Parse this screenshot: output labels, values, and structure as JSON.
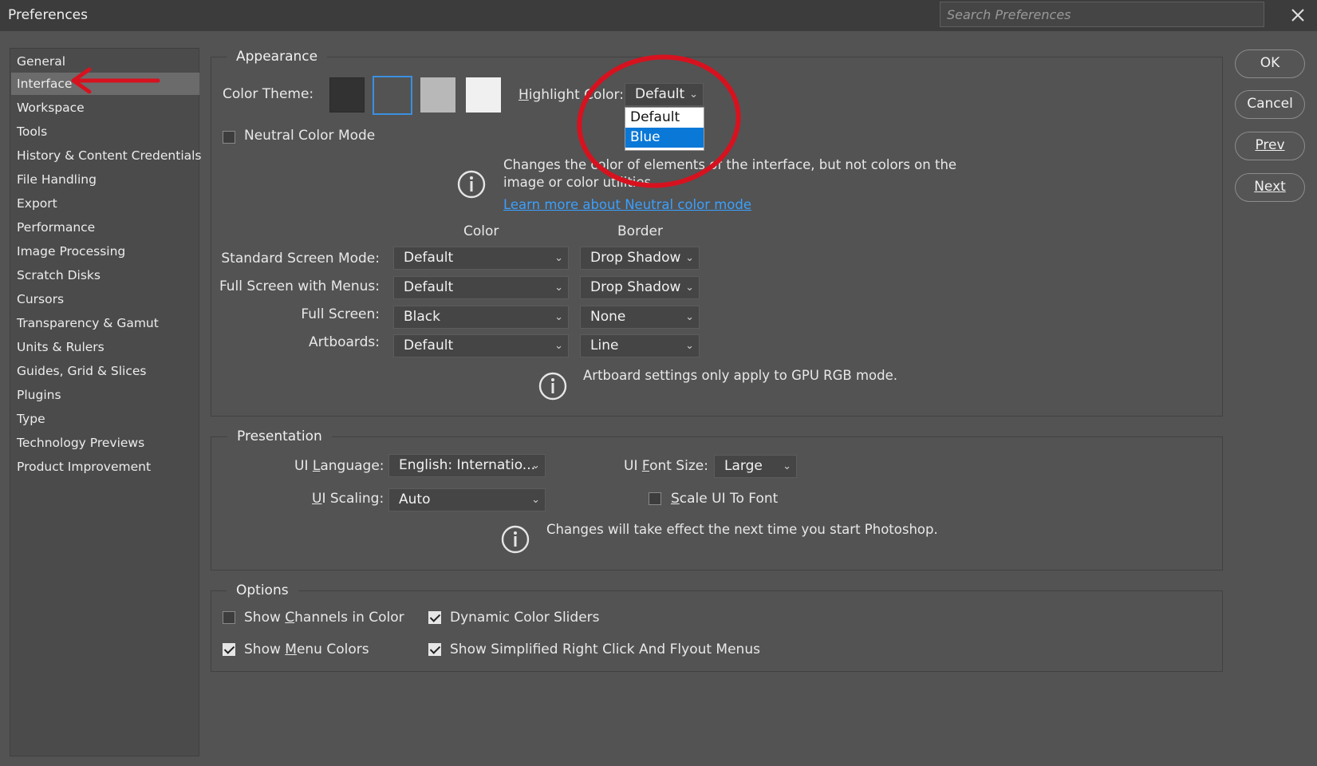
{
  "window": {
    "title": "Preferences",
    "search_placeholder": "Search Preferences"
  },
  "sidebar": {
    "items": [
      {
        "label": "General"
      },
      {
        "label": "Interface",
        "selected": true
      },
      {
        "label": "Workspace"
      },
      {
        "label": "Tools"
      },
      {
        "label": "History & Content Credentials"
      },
      {
        "label": "File Handling"
      },
      {
        "label": "Export"
      },
      {
        "label": "Performance"
      },
      {
        "label": "Image Processing"
      },
      {
        "label": "Scratch Disks"
      },
      {
        "label": "Cursors"
      },
      {
        "label": "Transparency & Gamut"
      },
      {
        "label": "Units & Rulers"
      },
      {
        "label": "Guides, Grid & Slices"
      },
      {
        "label": "Plugins"
      },
      {
        "label": "Type"
      },
      {
        "label": "Technology Previews"
      },
      {
        "label": "Product Improvement"
      }
    ]
  },
  "appearance": {
    "legend": "Appearance",
    "color_theme_label": "Color Theme:",
    "theme_colors": [
      "#323232",
      "#535353",
      "#b8b8b8",
      "#f0f0f0"
    ],
    "selected_theme_index": 1,
    "highlight_label_h": "H",
    "highlight_label_rest": "ighlight Color:",
    "highlight_value": "Default",
    "highlight_options": [
      "Default",
      "Blue"
    ],
    "highlight_hovered": "Blue",
    "neutral_mode_label": "Neutral Color Mode",
    "neutral_mode_checked": false,
    "neutral_info_line1": "Changes the color of elements of the interface, but not colors on the",
    "neutral_info_line2": "image or color utilities",
    "neutral_link": "Learn more about Neutral color mode",
    "col_color": "Color",
    "col_border": "Border",
    "rows": [
      {
        "label": "Standard Screen Mode:",
        "color": "Default",
        "border": "Drop Shadow"
      },
      {
        "label": "Full Screen with Menus:",
        "color": "Default",
        "border": "Drop Shadow"
      },
      {
        "label": "Full Screen:",
        "color": "Black",
        "border": "None"
      },
      {
        "label": "Artboards:",
        "color": "Default",
        "border": "Line"
      }
    ],
    "artboard_info": "Artboard settings only apply to GPU RGB mode."
  },
  "presentation": {
    "legend": "Presentation",
    "ui_language_label_pre": "UI ",
    "ui_language_label_u": "L",
    "ui_language_label_post": "anguage:",
    "ui_language_value": "English: Internatio...",
    "ui_font_size_label_pre": "UI ",
    "ui_font_size_label_u": "F",
    "ui_font_size_label_post": "ont Size:",
    "ui_font_size_value": "Large",
    "ui_scaling_label_u": "U",
    "ui_scaling_label_post": "I Scaling:",
    "ui_scaling_value": "Auto",
    "scale_to_font_u": "S",
    "scale_to_font_post": "cale UI To Font",
    "scale_to_font_checked": false,
    "restart_info": "Changes will take effect the next time you start Photoshop."
  },
  "options": {
    "legend": "Options",
    "show_channels_pre": "Show ",
    "show_channels_u": "C",
    "show_channels_post": "hannels in Color",
    "show_channels_checked": false,
    "dynamic_sliders": "Dynamic Color Sliders",
    "dynamic_sliders_checked": true,
    "show_menu_pre": "Show ",
    "show_menu_u": "M",
    "show_menu_post": "enu Colors",
    "show_menu_checked": true,
    "simplified_menus": "Show Simplified Right Click And Flyout Menus",
    "simplified_menus_checked": true
  },
  "buttons": {
    "ok": "OK",
    "cancel": "Cancel",
    "prev": "Prev",
    "next": "Next"
  },
  "annotation_color": "#d7121f"
}
